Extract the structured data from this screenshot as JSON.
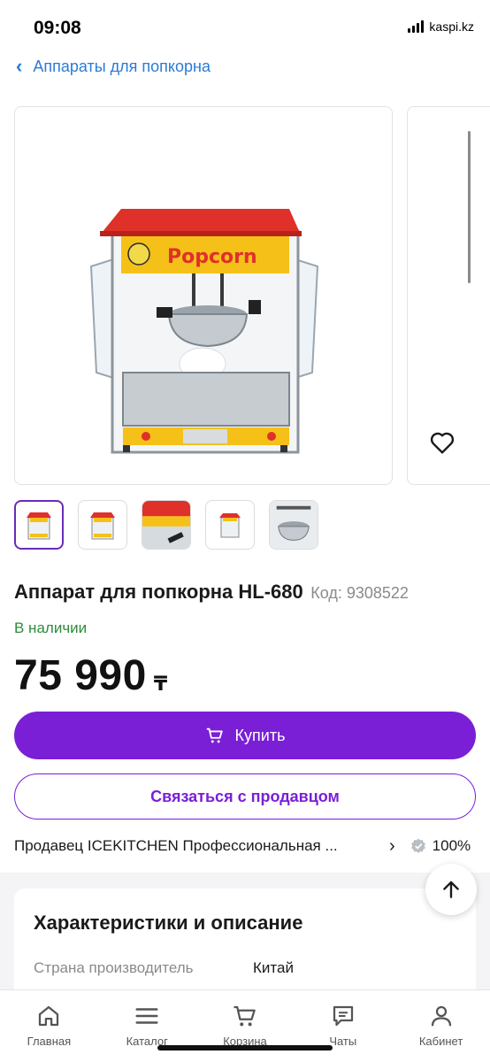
{
  "status": {
    "time": "09:08",
    "carrier": "kaspi.kz"
  },
  "nav": {
    "back_label": "Аппараты для попкорна"
  },
  "product": {
    "title": "Аппарат для попкорна HL-680",
    "code": "Код: 9308522",
    "stock": "В наличии",
    "price": "75 990",
    "currency": "₸"
  },
  "actions": {
    "buy_label": "Купить",
    "contact_label": "Связаться с продавцом"
  },
  "seller": {
    "text": "Продавец ICEKITCHEN Профессиональная ...",
    "rating": "100%"
  },
  "characteristics": {
    "title": "Характеристики и описание",
    "rows": [
      {
        "key": "Страна производитель",
        "value": "Китай"
      }
    ]
  },
  "tabbar": {
    "items": [
      {
        "label": "Главная",
        "icon": "home-icon"
      },
      {
        "label": "Каталог",
        "icon": "menu-icon"
      },
      {
        "label": "Корзина",
        "icon": "cart-icon"
      },
      {
        "label": "Чаты",
        "icon": "chat-icon"
      },
      {
        "label": "Кабинет",
        "icon": "user-icon"
      }
    ]
  },
  "colors": {
    "accent": "#7a1fd6",
    "link": "#2b7bd6",
    "in_stock": "#2e8b3a",
    "machine_roof": "#e0302a"
  }
}
